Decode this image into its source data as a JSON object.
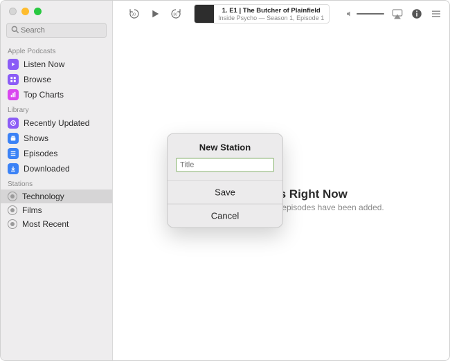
{
  "sidebar": {
    "search_placeholder": "Search",
    "sections": {
      "apple_podcasts": {
        "label": "Apple Podcasts",
        "items": [
          "Listen Now",
          "Browse",
          "Top Charts"
        ]
      },
      "library": {
        "label": "Library",
        "items": [
          "Recently Updated",
          "Shows",
          "Episodes",
          "Downloaded"
        ]
      },
      "stations": {
        "label": "Stations",
        "items": [
          "Technology",
          "Films",
          "Most Recent"
        ]
      }
    }
  },
  "toolbar": {
    "now_playing": {
      "title": "1. E1 | The Butcher of Plainfield",
      "subtitle": "Inside Psycho — Season 1, Episode 1"
    }
  },
  "content": {
    "empty_title": "No Episodes Right Now",
    "empty_sub": "Check back later when new episodes have been added."
  },
  "modal": {
    "title": "New Station",
    "input_placeholder": "Title",
    "save": "Save",
    "cancel": "Cancel"
  }
}
